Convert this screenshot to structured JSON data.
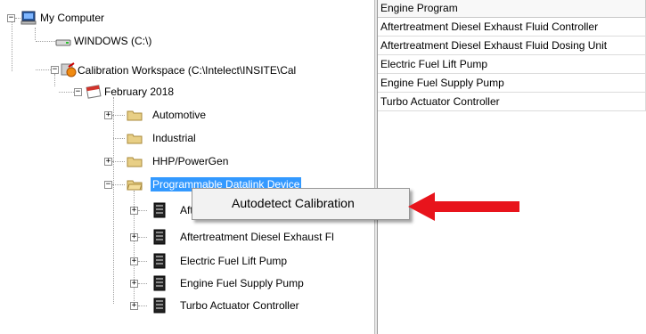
{
  "tree": {
    "nodes": [
      {
        "label": "My Computer",
        "icon": "computer-icon"
      },
      {
        "label": "WINDOWS  (C:\\)",
        "icon": "drive-icon"
      },
      {
        "label": "Calibration Workspace  (C:\\Intelect\\INSITE\\Cal",
        "icon": "workspace-icon"
      },
      {
        "label": "February 2018",
        "icon": "calendar-icon"
      },
      {
        "label": "Automotive",
        "icon": "folder-icon"
      },
      {
        "label": "Industrial",
        "icon": "folder-icon"
      },
      {
        "label": "HHP/PowerGen",
        "icon": "folder-icon"
      },
      {
        "label": "Programmable Datalink Device",
        "icon": "folder-open-icon"
      },
      {
        "label": "Aftertreatment Diesel Exhaust Fluid Controller",
        "icon": "module-icon"
      },
      {
        "label": "Aftertreatment Diesel Exhaust Fl",
        "icon": "module-icon"
      },
      {
        "label": "Electric Fuel Lift Pump",
        "icon": "module-icon"
      },
      {
        "label": "Engine Fuel Supply Pump",
        "icon": "module-icon"
      },
      {
        "label": "Turbo Actuator Controller",
        "icon": "module-icon"
      }
    ]
  },
  "list": {
    "header": "Engine Program",
    "rows": [
      "Aftertreatment Diesel Exhaust Fluid Controller",
      "Aftertreatment Diesel Exhaust Fluid Dosing Unit",
      "Electric Fuel Lift Pump",
      "Engine Fuel Supply Pump",
      "Turbo Actuator Controller"
    ]
  },
  "context_menu": {
    "item": "Autodetect Calibration"
  },
  "colors": {
    "selection": "#3399ff",
    "arrow": "#e8141c"
  }
}
